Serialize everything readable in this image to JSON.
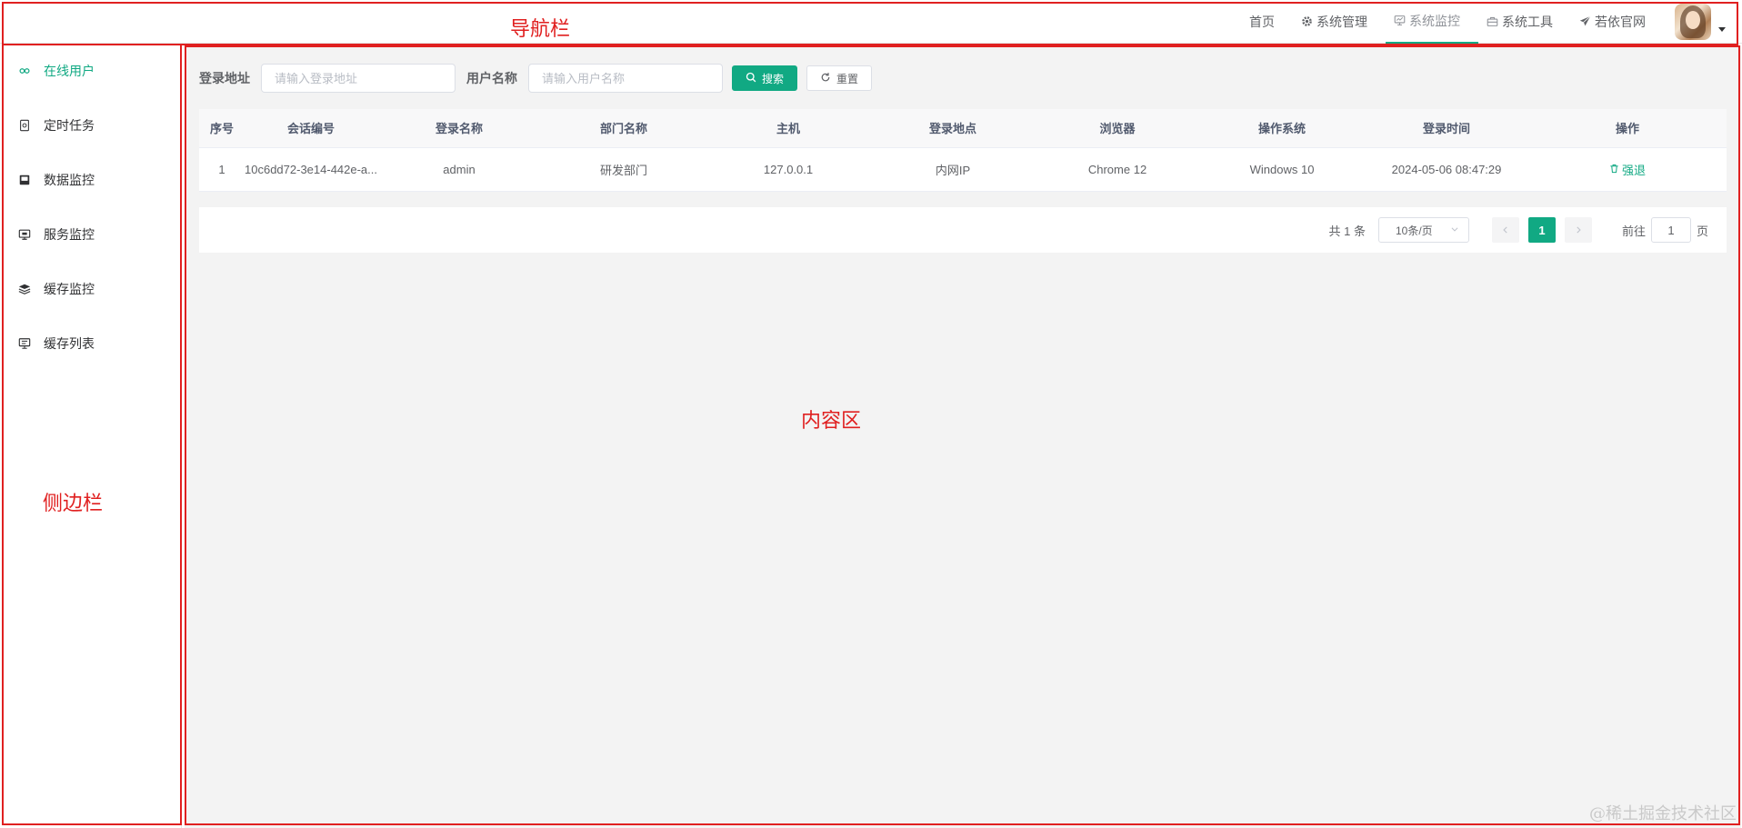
{
  "annotations": {
    "navbar_label": "导航栏",
    "sidebar_label": "侧边栏",
    "content_label": "内容区"
  },
  "navbar": {
    "items": [
      {
        "label": "首页",
        "icon": "none"
      },
      {
        "label": "系统管理",
        "icon": "gear-icon"
      },
      {
        "label": "系统监控",
        "icon": "monitor-icon",
        "active": true
      },
      {
        "label": "系统工具",
        "icon": "toolbox-icon"
      },
      {
        "label": "若依官网",
        "icon": "paper-plane-icon"
      }
    ]
  },
  "sidebar": {
    "items": [
      {
        "label": "在线用户",
        "icon": "online-icon",
        "active": true
      },
      {
        "label": "定时任务",
        "icon": "job-icon"
      },
      {
        "label": "数据监控",
        "icon": "druid-icon"
      },
      {
        "label": "服务监控",
        "icon": "server-icon"
      },
      {
        "label": "缓存监控",
        "icon": "redis-icon"
      },
      {
        "label": "缓存列表",
        "icon": "redis-list-icon"
      }
    ]
  },
  "search": {
    "ipaddr_label": "登录地址",
    "ipaddr_placeholder": "请输入登录地址",
    "username_label": "用户名称",
    "username_placeholder": "请输入用户名称",
    "search_button": "搜索",
    "reset_button": "重置"
  },
  "table": {
    "headers": [
      "序号",
      "会话编号",
      "登录名称",
      "部门名称",
      "主机",
      "登录地点",
      "浏览器",
      "操作系统",
      "登录时间",
      "操作"
    ],
    "rows": [
      {
        "index": "1",
        "token": "10c6dd72-3e14-442e-a...",
        "username": "admin",
        "dept": "研发部门",
        "host": "127.0.0.1",
        "location": "内网IP",
        "browser": "Chrome 12",
        "os": "Windows 10",
        "login_time": "2024-05-06 08:47:29",
        "action": "强退"
      }
    ]
  },
  "pagination": {
    "total": "共 1 条",
    "page_size": "10条/页",
    "current_page": "1",
    "goto_prefix": "前往",
    "goto_value": "1",
    "goto_suffix": "页"
  },
  "watermark": "@稀土掘金技术社区",
  "colors": {
    "accent": "#11a983",
    "annotation": "#e02020"
  }
}
